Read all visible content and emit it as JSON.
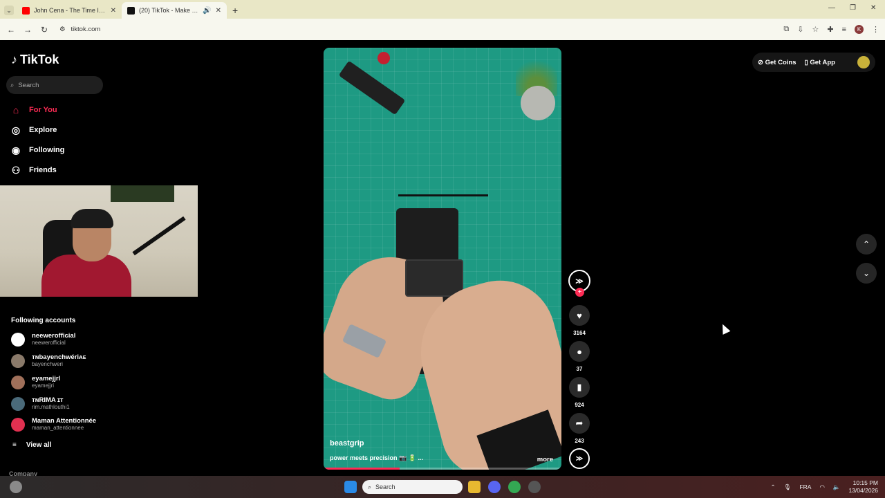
{
  "browser": {
    "tabs": [
      {
        "title": "John Cena - The Time Is Now (",
        "favicon": "youtube-icon"
      },
      {
        "title": "(20) TikTok - Make Your Day",
        "favicon": "tiktok-icon",
        "active": true
      }
    ],
    "url": "tiktok.com"
  },
  "sidebar": {
    "logo": "TikTok",
    "search_placeholder": "Search",
    "nav": [
      {
        "label": "For You",
        "icon": "home-icon"
      },
      {
        "label": "Explore",
        "icon": "compass-icon"
      },
      {
        "label": "Following",
        "icon": "following-icon"
      },
      {
        "label": "Friends",
        "icon": "friends-icon"
      }
    ],
    "following_title": "Following accounts",
    "accounts": [
      {
        "name": "neewerofficial",
        "handle": "neewerofficial",
        "color": "#ffffff"
      },
      {
        "name": "ᴛɴbayenchwériᴀᴇ",
        "handle": "bayenchweri",
        "color": "#8a7a6a"
      },
      {
        "name": "eyamejjrl",
        "handle": "eyamejjri",
        "color": "#a0705a"
      },
      {
        "name": "ᴛɴRIMA ɪᴛ",
        "handle": "rim.mathlouthi1",
        "color": "#4a6a7a"
      },
      {
        "name": "Maman Attentionnée",
        "handle": "maman_attentionnee",
        "color": "#e03050"
      }
    ],
    "view_all": "View all",
    "company": "Company"
  },
  "video": {
    "author": "beastgrip",
    "description": "power meets precision 📷 🔋 ...",
    "more": "more",
    "progress": 0.32
  },
  "actions": {
    "likes": "3164",
    "comments": "37",
    "saves": "924",
    "shares": "243"
  },
  "topbar": {
    "coins": "Get Coins",
    "app": "Get App"
  },
  "taskbar": {
    "search": "Search",
    "lang": "FRA",
    "time": "10:15 PM",
    "date": "13/04/2026"
  }
}
